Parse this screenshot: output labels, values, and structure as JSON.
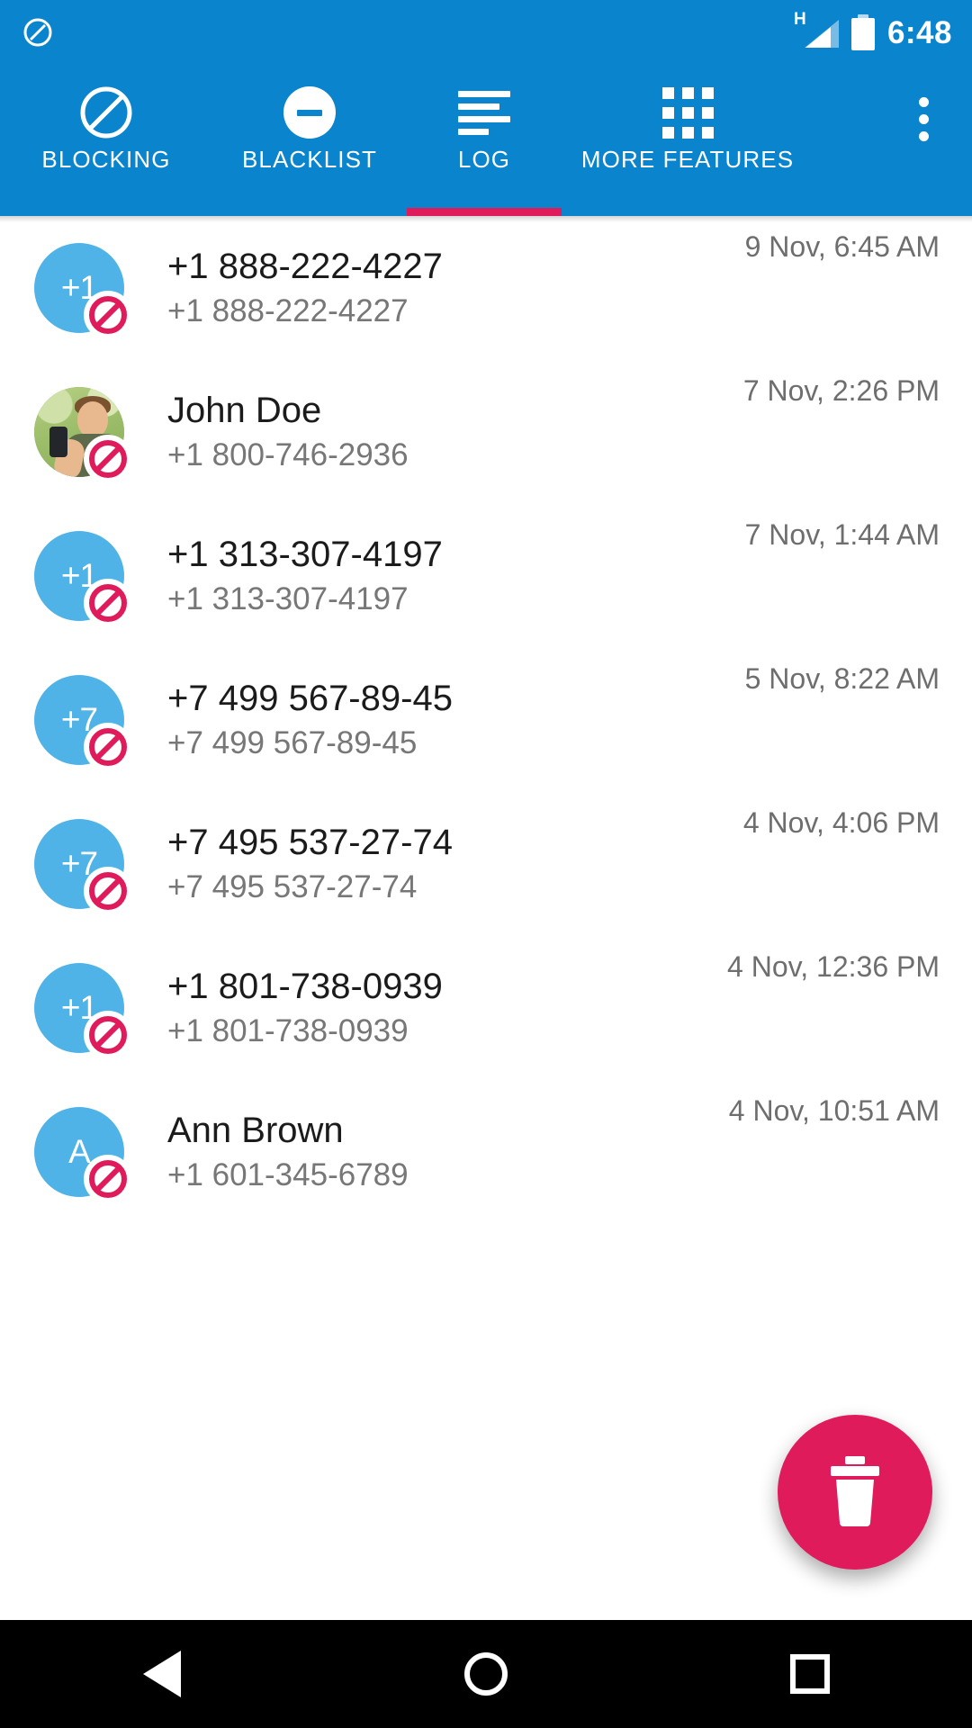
{
  "statusbar": {
    "app_icon": "block-circle-icon",
    "network_type": "H",
    "signal_icon": "signal-bars-icon",
    "battery_icon": "battery-full-icon",
    "clock": "6:48"
  },
  "tabs": [
    {
      "label": "BLOCKING",
      "icon": "ban-icon",
      "active": false
    },
    {
      "label": "BLACKLIST",
      "icon": "minus-circle-icon",
      "active": false
    },
    {
      "label": "LOG",
      "icon": "list-lines-icon",
      "active": true
    },
    {
      "label": "MORE FEATURES",
      "icon": "grid-apps-icon",
      "active": false
    }
  ],
  "overflow_menu": {
    "name": "overflow-menu-icon",
    "dots": 3
  },
  "log": {
    "rows": [
      {
        "avatar_type": "initials",
        "avatar_text": "+1",
        "title": "+1 888-222-4227",
        "subtitle": "+1 888-222-4227",
        "time": "9 Nov, 6:45 AM",
        "blocked": true
      },
      {
        "avatar_type": "photo",
        "avatar_text": "",
        "title": "John Doe",
        "subtitle": "+1 800-746-2936",
        "time": "7 Nov, 2:26 PM",
        "blocked": true
      },
      {
        "avatar_type": "initials",
        "avatar_text": "+1",
        "title": "+1 313-307-4197",
        "subtitle": "+1 313-307-4197",
        "time": "7 Nov, 1:44 AM",
        "blocked": true
      },
      {
        "avatar_type": "initials",
        "avatar_text": "+7",
        "title": "+7 499 567-89-45",
        "subtitle": "+7 499 567-89-45",
        "time": "5 Nov, 8:22 AM",
        "blocked": true
      },
      {
        "avatar_type": "initials",
        "avatar_text": "+7",
        "title": "+7 495 537-27-74",
        "subtitle": "+7 495 537-27-74",
        "time": "4 Nov, 4:06 PM",
        "blocked": true
      },
      {
        "avatar_type": "initials",
        "avatar_text": "+1",
        "title": "+1 801-738-0939",
        "subtitle": "+1 801-738-0939",
        "time": "4 Nov, 12:36 PM",
        "blocked": true
      },
      {
        "avatar_type": "initials",
        "avatar_text": "A",
        "title": "Ann Brown",
        "subtitle": "+1 601-345-6789",
        "time": "4 Nov, 10:51 AM",
        "blocked": true
      }
    ]
  },
  "fab": {
    "name": "delete-fab",
    "icon": "trash-icon"
  },
  "navbar": {
    "back": "back-triangle-icon",
    "home": "home-circle-icon",
    "recents": "recents-square-icon"
  },
  "colors": {
    "primary": "#0B84CE",
    "accent": "#E01B5C",
    "avatar_blue": "#4FB3E8",
    "title_text": "#1B1B1B",
    "sub_text": "#777777",
    "time_text": "#6E6E6E"
  }
}
